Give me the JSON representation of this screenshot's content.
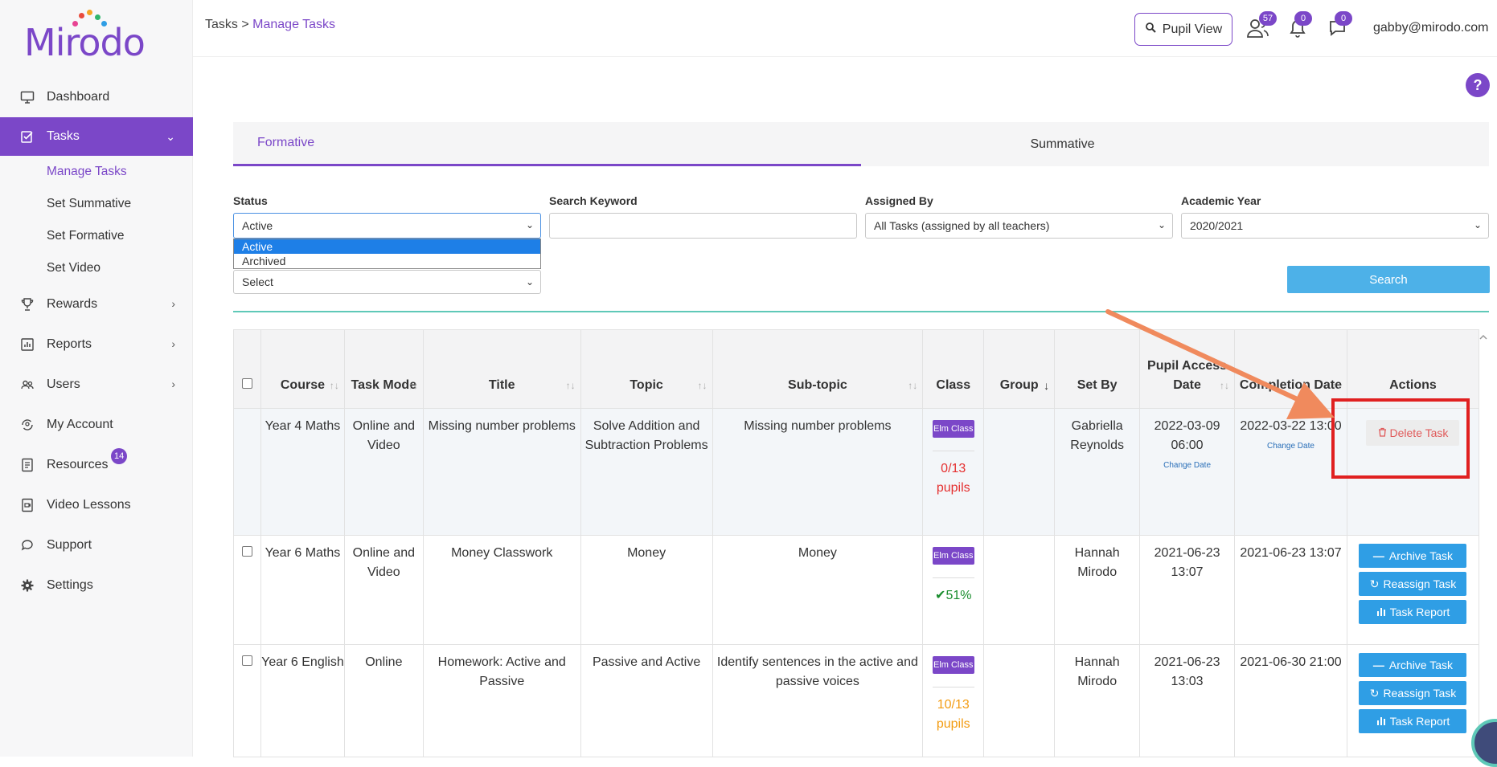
{
  "brand": {
    "logo_text": "Mirodo"
  },
  "sidebar": {
    "items": [
      {
        "label": "Dashboard",
        "icon": "monitor-icon"
      },
      {
        "label": "Tasks",
        "icon": "tasks-icon"
      },
      {
        "label": "Rewards",
        "icon": "trophy-icon"
      },
      {
        "label": "Reports",
        "icon": "reports-icon"
      },
      {
        "label": "Users",
        "icon": "users-icon"
      },
      {
        "label": "My Account",
        "icon": "account-icon"
      },
      {
        "label": "Resources",
        "icon": "resources-icon",
        "badge": "14"
      },
      {
        "label": "Video Lessons",
        "icon": "video-icon"
      },
      {
        "label": "Support",
        "icon": "support-icon"
      },
      {
        "label": "Settings",
        "icon": "gear-icon"
      }
    ],
    "task_subitems": [
      "Manage Tasks",
      "Set Summative",
      "Set Formative",
      "Set Video"
    ]
  },
  "header": {
    "breadcrumb_root": "Tasks",
    "breadcrumb_sep": ">",
    "breadcrumb_current": "Manage Tasks",
    "pupil_view": "Pupil View",
    "users_badge": "57",
    "notifications_badge": "0",
    "messages_badge": "0",
    "user_email": "gabby@mirodo.com",
    "help": "?"
  },
  "tabs": {
    "formative": "Formative",
    "summative": "Summative"
  },
  "filters": {
    "status_label": "Status",
    "status_value": "Active",
    "status_options": [
      "Active",
      "Archived"
    ],
    "keyword_label": "Search Keyword",
    "keyword_value": "",
    "assigned_label": "Assigned By",
    "assigned_value": "All Tasks (assigned by all teachers)",
    "year_label": "Academic Year",
    "year_value": "2020/2021",
    "second_select_value": "Select",
    "search_button": "Search"
  },
  "table": {
    "headers": {
      "course": "Course",
      "task_mode": "Task Mode",
      "title": "Title",
      "topic": "Topic",
      "subtopic": "Sub-topic",
      "class": "Class",
      "group": "Group",
      "set_by": "Set By",
      "pupil_access_date": "Pupil Access Date",
      "completion_date": "Completion Date",
      "actions": "Actions"
    },
    "rows": [
      {
        "course": "Year 4 Maths",
        "task_mode": "Online and Video",
        "title": "Missing number problems",
        "topic": "Solve Addition and Subtraction Problems",
        "subtopic": "Missing number problems",
        "class": "Elm Class",
        "stat": "0/13 pupils",
        "group": "",
        "set_by": "Gabriella Reynolds",
        "access_date": "2022-03-09 06:00",
        "completion_date": "2022-03-22 13:00",
        "change_date": "Change Date",
        "delete": "Delete Task"
      },
      {
        "course": "Year 6 Maths",
        "task_mode": "Online and Video",
        "title": "Money Classwork",
        "topic": "Money",
        "subtopic": "Money",
        "class": "Elm Class",
        "stat": "51%",
        "group": "",
        "set_by": "Hannah Mirodo",
        "access_date": "2021-06-23 13:07",
        "completion_date": "2021-06-23 13:07",
        "archive": "Archive Task",
        "reassign": "Reassign Task",
        "report": "Task Report"
      },
      {
        "course": "Year 6 English",
        "task_mode": "Online",
        "title": "Homework: Active and Passive",
        "topic": "Passive and Active",
        "subtopic": "Identify sentences in the active and passive voices",
        "class": "Elm Class",
        "stat": "10/13 pupils",
        "group": "",
        "set_by": "Hannah Mirodo",
        "access_date": "2021-06-23 13:03",
        "completion_date": "2021-06-30 21:00",
        "archive": "Archive Task",
        "reassign": "Reassign Task",
        "report": "Task Report"
      }
    ]
  },
  "colors": {
    "brand": "#7b47c8",
    "search": "#4db1e8",
    "action": "#2f9ee5",
    "highlight": "#e02020",
    "arrow": "#f08a5d"
  }
}
